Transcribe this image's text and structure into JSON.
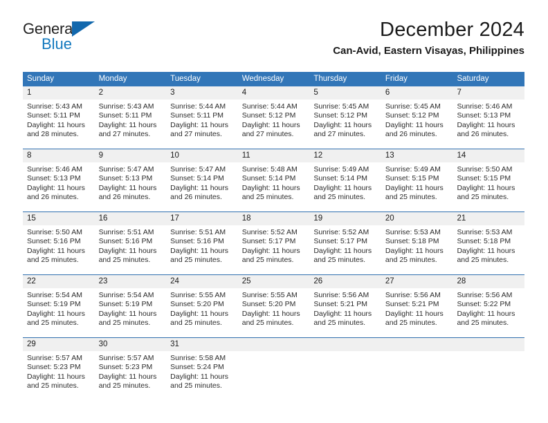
{
  "brand": {
    "name_top": "General",
    "name_bottom": "Blue",
    "logo_icon": "triangle-logo-icon"
  },
  "header": {
    "month_title": "December 2024",
    "location": "Can-Avid, Eastern Visayas, Philippines"
  },
  "colors": {
    "header_blue": "#3276b8",
    "row_divider_blue": "#2f6fae",
    "day_number_bg": "#f0f0f0",
    "brand_blue": "#1278be",
    "logo_blue": "#1268ad"
  },
  "calendar": {
    "weekdays": [
      "Sunday",
      "Monday",
      "Tuesday",
      "Wednesday",
      "Thursday",
      "Friday",
      "Saturday"
    ],
    "weeks": [
      [
        {
          "day": "1",
          "sunrise": "Sunrise: 5:43 AM",
          "sunset": "Sunset: 5:11 PM",
          "daylight_line1": "Daylight: 11 hours",
          "daylight_line2": "and 28 minutes."
        },
        {
          "day": "2",
          "sunrise": "Sunrise: 5:43 AM",
          "sunset": "Sunset: 5:11 PM",
          "daylight_line1": "Daylight: 11 hours",
          "daylight_line2": "and 27 minutes."
        },
        {
          "day": "3",
          "sunrise": "Sunrise: 5:44 AM",
          "sunset": "Sunset: 5:11 PM",
          "daylight_line1": "Daylight: 11 hours",
          "daylight_line2": "and 27 minutes."
        },
        {
          "day": "4",
          "sunrise": "Sunrise: 5:44 AM",
          "sunset": "Sunset: 5:12 PM",
          "daylight_line1": "Daylight: 11 hours",
          "daylight_line2": "and 27 minutes."
        },
        {
          "day": "5",
          "sunrise": "Sunrise: 5:45 AM",
          "sunset": "Sunset: 5:12 PM",
          "daylight_line1": "Daylight: 11 hours",
          "daylight_line2": "and 27 minutes."
        },
        {
          "day": "6",
          "sunrise": "Sunrise: 5:45 AM",
          "sunset": "Sunset: 5:12 PM",
          "daylight_line1": "Daylight: 11 hours",
          "daylight_line2": "and 26 minutes."
        },
        {
          "day": "7",
          "sunrise": "Sunrise: 5:46 AM",
          "sunset": "Sunset: 5:13 PM",
          "daylight_line1": "Daylight: 11 hours",
          "daylight_line2": "and 26 minutes."
        }
      ],
      [
        {
          "day": "8",
          "sunrise": "Sunrise: 5:46 AM",
          "sunset": "Sunset: 5:13 PM",
          "daylight_line1": "Daylight: 11 hours",
          "daylight_line2": "and 26 minutes."
        },
        {
          "day": "9",
          "sunrise": "Sunrise: 5:47 AM",
          "sunset": "Sunset: 5:13 PM",
          "daylight_line1": "Daylight: 11 hours",
          "daylight_line2": "and 26 minutes."
        },
        {
          "day": "10",
          "sunrise": "Sunrise: 5:47 AM",
          "sunset": "Sunset: 5:14 PM",
          "daylight_line1": "Daylight: 11 hours",
          "daylight_line2": "and 26 minutes."
        },
        {
          "day": "11",
          "sunrise": "Sunrise: 5:48 AM",
          "sunset": "Sunset: 5:14 PM",
          "daylight_line1": "Daylight: 11 hours",
          "daylight_line2": "and 25 minutes."
        },
        {
          "day": "12",
          "sunrise": "Sunrise: 5:49 AM",
          "sunset": "Sunset: 5:14 PM",
          "daylight_line1": "Daylight: 11 hours",
          "daylight_line2": "and 25 minutes."
        },
        {
          "day": "13",
          "sunrise": "Sunrise: 5:49 AM",
          "sunset": "Sunset: 5:15 PM",
          "daylight_line1": "Daylight: 11 hours",
          "daylight_line2": "and 25 minutes."
        },
        {
          "day": "14",
          "sunrise": "Sunrise: 5:50 AM",
          "sunset": "Sunset: 5:15 PM",
          "daylight_line1": "Daylight: 11 hours",
          "daylight_line2": "and 25 minutes."
        }
      ],
      [
        {
          "day": "15",
          "sunrise": "Sunrise: 5:50 AM",
          "sunset": "Sunset: 5:16 PM",
          "daylight_line1": "Daylight: 11 hours",
          "daylight_line2": "and 25 minutes."
        },
        {
          "day": "16",
          "sunrise": "Sunrise: 5:51 AM",
          "sunset": "Sunset: 5:16 PM",
          "daylight_line1": "Daylight: 11 hours",
          "daylight_line2": "and 25 minutes."
        },
        {
          "day": "17",
          "sunrise": "Sunrise: 5:51 AM",
          "sunset": "Sunset: 5:16 PM",
          "daylight_line1": "Daylight: 11 hours",
          "daylight_line2": "and 25 minutes."
        },
        {
          "day": "18",
          "sunrise": "Sunrise: 5:52 AM",
          "sunset": "Sunset: 5:17 PM",
          "daylight_line1": "Daylight: 11 hours",
          "daylight_line2": "and 25 minutes."
        },
        {
          "day": "19",
          "sunrise": "Sunrise: 5:52 AM",
          "sunset": "Sunset: 5:17 PM",
          "daylight_line1": "Daylight: 11 hours",
          "daylight_line2": "and 25 minutes."
        },
        {
          "day": "20",
          "sunrise": "Sunrise: 5:53 AM",
          "sunset": "Sunset: 5:18 PM",
          "daylight_line1": "Daylight: 11 hours",
          "daylight_line2": "and 25 minutes."
        },
        {
          "day": "21",
          "sunrise": "Sunrise: 5:53 AM",
          "sunset": "Sunset: 5:18 PM",
          "daylight_line1": "Daylight: 11 hours",
          "daylight_line2": "and 25 minutes."
        }
      ],
      [
        {
          "day": "22",
          "sunrise": "Sunrise: 5:54 AM",
          "sunset": "Sunset: 5:19 PM",
          "daylight_line1": "Daylight: 11 hours",
          "daylight_line2": "and 25 minutes."
        },
        {
          "day": "23",
          "sunrise": "Sunrise: 5:54 AM",
          "sunset": "Sunset: 5:19 PM",
          "daylight_line1": "Daylight: 11 hours",
          "daylight_line2": "and 25 minutes."
        },
        {
          "day": "24",
          "sunrise": "Sunrise: 5:55 AM",
          "sunset": "Sunset: 5:20 PM",
          "daylight_line1": "Daylight: 11 hours",
          "daylight_line2": "and 25 minutes."
        },
        {
          "day": "25",
          "sunrise": "Sunrise: 5:55 AM",
          "sunset": "Sunset: 5:20 PM",
          "daylight_line1": "Daylight: 11 hours",
          "daylight_line2": "and 25 minutes."
        },
        {
          "day": "26",
          "sunrise": "Sunrise: 5:56 AM",
          "sunset": "Sunset: 5:21 PM",
          "daylight_line1": "Daylight: 11 hours",
          "daylight_line2": "and 25 minutes."
        },
        {
          "day": "27",
          "sunrise": "Sunrise: 5:56 AM",
          "sunset": "Sunset: 5:21 PM",
          "daylight_line1": "Daylight: 11 hours",
          "daylight_line2": "and 25 minutes."
        },
        {
          "day": "28",
          "sunrise": "Sunrise: 5:56 AM",
          "sunset": "Sunset: 5:22 PM",
          "daylight_line1": "Daylight: 11 hours",
          "daylight_line2": "and 25 minutes."
        }
      ],
      [
        {
          "day": "29",
          "sunrise": "Sunrise: 5:57 AM",
          "sunset": "Sunset: 5:23 PM",
          "daylight_line1": "Daylight: 11 hours",
          "daylight_line2": "and 25 minutes."
        },
        {
          "day": "30",
          "sunrise": "Sunrise: 5:57 AM",
          "sunset": "Sunset: 5:23 PM",
          "daylight_line1": "Daylight: 11 hours",
          "daylight_line2": "and 25 minutes."
        },
        {
          "day": "31",
          "sunrise": "Sunrise: 5:58 AM",
          "sunset": "Sunset: 5:24 PM",
          "daylight_line1": "Daylight: 11 hours",
          "daylight_line2": "and 25 minutes."
        },
        {
          "day": "",
          "sunrise": "",
          "sunset": "",
          "daylight_line1": "",
          "daylight_line2": ""
        },
        {
          "day": "",
          "sunrise": "",
          "sunset": "",
          "daylight_line1": "",
          "daylight_line2": ""
        },
        {
          "day": "",
          "sunrise": "",
          "sunset": "",
          "daylight_line1": "",
          "daylight_line2": ""
        },
        {
          "day": "",
          "sunrise": "",
          "sunset": "",
          "daylight_line1": "",
          "daylight_line2": ""
        }
      ]
    ]
  }
}
